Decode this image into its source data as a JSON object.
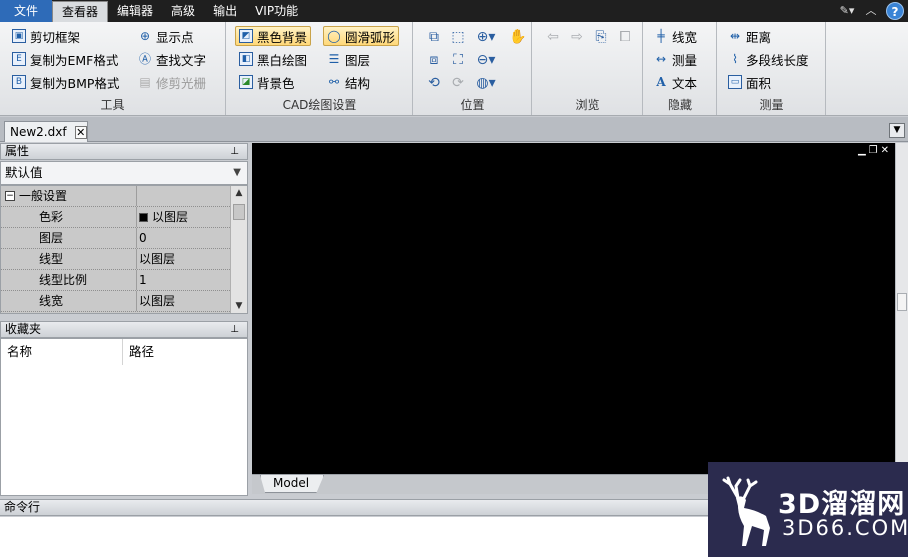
{
  "menu": {
    "items": [
      "文件",
      "查看器",
      "编辑器",
      "高级",
      "输出",
      "VIP功能"
    ],
    "active": "查看器",
    "help_glyph": "?"
  },
  "ribbon": {
    "tools": {
      "label": "工具",
      "buttons": [
        "剪切框架",
        "复制为EMF格式",
        "复制为BMP格式",
        "显示点",
        "查找文字",
        "修剪光栅"
      ],
      "disabled": [
        "修剪光栅"
      ]
    },
    "cad_settings": {
      "label": "CAD绘图设置",
      "buttons": [
        "黑色背景",
        "黑白绘图",
        "背景色",
        "圆滑弧形",
        "图层",
        "结构"
      ],
      "toggled_on": [
        "黑色背景",
        "圆滑弧形"
      ]
    },
    "position": {
      "label": "位置"
    },
    "browse": {
      "label": "浏览"
    },
    "hide": {
      "label": "隐藏",
      "buttons": [
        "线宽",
        "测量",
        "文本"
      ]
    },
    "measure": {
      "label": "测量",
      "buttons": [
        "距离",
        "多段线长度",
        "面积"
      ]
    }
  },
  "document": {
    "tab_title": "New2.dxf"
  },
  "properties": {
    "title": "属性",
    "selector_value": "默认值",
    "category": "一般设置",
    "rows": [
      {
        "key": "色彩",
        "value": "以图层"
      },
      {
        "key": "图层",
        "value": "0"
      },
      {
        "key": "线型",
        "value": "以图层"
      },
      {
        "key": "线型比例",
        "value": "1"
      },
      {
        "key": "线宽",
        "value": "以图层"
      }
    ]
  },
  "favorites": {
    "title": "收藏夹",
    "columns": [
      "名称",
      "路径"
    ]
  },
  "layout_tabs": [
    "Model"
  ],
  "command_line": {
    "title": "命令行"
  },
  "watermark": {
    "line1": "3D溜溜网",
    "line2": "3D66.COM"
  },
  "colors": {
    "menubar": "#1f1f1f",
    "file_menu": "#2e6bb8",
    "canvas": "#000000",
    "toggle_on": "#ffd879",
    "watermark_bg": "#2b2b4e"
  }
}
